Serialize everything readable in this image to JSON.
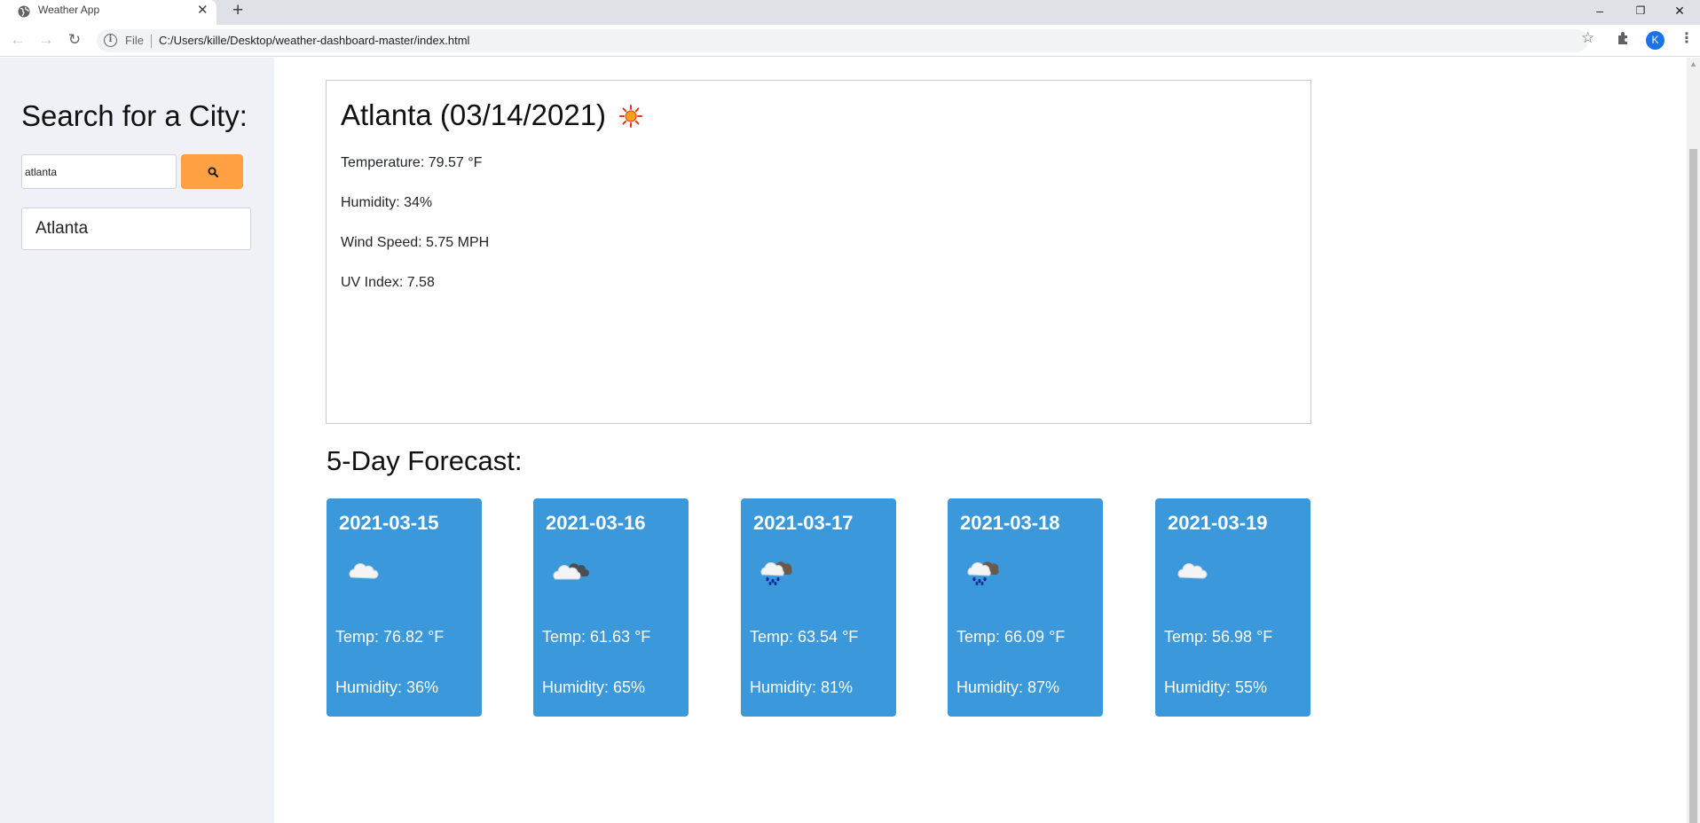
{
  "browser": {
    "tab_title": "Weather App",
    "tab_close": "✕",
    "new_tab": "+",
    "address_scheme": "File",
    "address_url": "C:/Users/kille/Desktop/weather-dashboard-master/index.html",
    "profile_initial": "K",
    "window_controls": {
      "minimize": "–",
      "restore": "❐",
      "close": "✕"
    },
    "nav": {
      "back": "←",
      "forward": "→",
      "reload": "↻"
    }
  },
  "sidebar": {
    "title": "Search for a City:",
    "search_value": "atlanta",
    "search_button_icon": "search-icon",
    "history": [
      "Atlanta"
    ]
  },
  "current": {
    "title": "Atlanta (03/14/2021)",
    "icon": "sun-icon",
    "temperature": "Temperature: 79.57 °F",
    "humidity": "Humidity: 34%",
    "wind": "Wind Speed: 5.75 MPH",
    "uv": "UV Index: 7.58"
  },
  "forecast": {
    "title": "5-Day Forecast:",
    "days": [
      {
        "date": "2021-03-15",
        "icon": "cloud-icon",
        "temp": "Temp: 76.82 °F",
        "humidity": "Humidity: 36%"
      },
      {
        "date": "2021-03-16",
        "icon": "cloudy-icon",
        "temp": "Temp: 61.63 °F",
        "humidity": "Humidity: 65%"
      },
      {
        "date": "2021-03-17",
        "icon": "rain-icon",
        "temp": "Temp: 63.54 °F",
        "humidity": "Humidity: 81%"
      },
      {
        "date": "2021-03-18",
        "icon": "rain-icon",
        "temp": "Temp: 66.09 °F",
        "humidity": "Humidity: 87%"
      },
      {
        "date": "2021-03-19",
        "icon": "cloud-icon",
        "temp": "Temp: 56.98 °F",
        "humidity": "Humidity: 55%"
      }
    ]
  },
  "colors": {
    "sidebar_bg": "#eff1f7",
    "search_button": "#ffa143",
    "forecast_card": "#3a98db"
  }
}
